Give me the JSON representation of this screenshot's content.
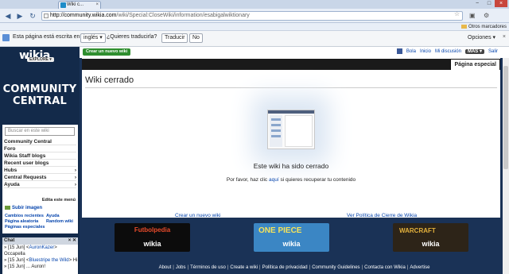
{
  "browser": {
    "tab_title": "Wiki c...",
    "tab_close": "×",
    "window_controls": [
      "−",
      "□",
      "×"
    ],
    "url_host": "http://community.wikia.com",
    "url_path": "/wiki/Special:CloseWiki/information/esabigalwiktionary",
    "bookmarks_other": "Otros marcadores"
  },
  "translate_bar": {
    "message": "Esta página está escrita en",
    "language": "inglés ▾",
    "question": "¿Quieres traducirla?",
    "translate_button": "Traducir",
    "no_button": "No",
    "options": "Opciones ▾",
    "close": "×"
  },
  "header": {
    "logo": "wikia",
    "explore": "EXPLORE ▾",
    "create_wiki": "Crear un nuevo wiki",
    "user_links": [
      "Bola",
      "Inicio",
      "Mi discusión"
    ],
    "more": "MÁS ▾",
    "logout": "Salir"
  },
  "sidebar": {
    "wiki_title": "COMMUNITY CENTRAL",
    "search_placeholder": "Buscar en este wiki",
    "nav": [
      {
        "label": "Community Central",
        "caret": ""
      },
      {
        "label": "Foro",
        "caret": ""
      },
      {
        "label": "Wikia Staff blogs",
        "caret": ""
      },
      {
        "label": "Recent user blogs",
        "caret": ""
      },
      {
        "label": "Hubs",
        "caret": "›"
      },
      {
        "label": "Central Requests",
        "caret": "›"
      },
      {
        "label": "Ayuda",
        "caret": "›"
      }
    ],
    "edit_menu": "Edita este menú",
    "upload": "Subir imagen",
    "tools": [
      [
        "Cambios recientes",
        "Ayuda"
      ],
      [
        "Página aleatoria",
        "Random wiki"
      ],
      [
        "Páginas especiales",
        ""
      ]
    ]
  },
  "chat": {
    "title": "Chat",
    "controls": "× ✕",
    "lines": [
      {
        "prefix": "» [15 Jun] <",
        "nick": "AuronKazer",
        "suffix": ">"
      },
      {
        "prefix": "Occapella",
        "nick": "",
        "suffix": ""
      },
      {
        "prefix": "» [15 Jun] <",
        "nick": "Bluestripe the Wild",
        "suffix": "> Hi"
      },
      {
        "prefix": "» [15 Jun] ... Auron!",
        "nick": "",
        "suffix": ""
      }
    ]
  },
  "content": {
    "special_tab": "Página especial",
    "title": "Wiki cerrado",
    "closed_message": "Este wiki ha sido cerrado",
    "recover_prefix": "Por favor, haz clic ",
    "recover_link": "aquí",
    "recover_suffix": " si quieres recuperar tu contenido",
    "create_link": "Crear un nuevo wiki",
    "policy_link": "Ver Política de Cierre de Wikia"
  },
  "spotlights": [
    {
      "title": "Futbolpedia",
      "brand": "wikia"
    },
    {
      "title": "ONE PIECE",
      "brand": "wikia"
    },
    {
      "title": "WARCRAFT",
      "brand": "wikia"
    }
  ],
  "footer": {
    "links": [
      "About",
      "Jobs",
      "Términos de uso",
      "Create a wiki",
      "Política de privacidad",
      "Community Guidelines",
      "Contacta con Wikia",
      "Advertise"
    ]
  }
}
